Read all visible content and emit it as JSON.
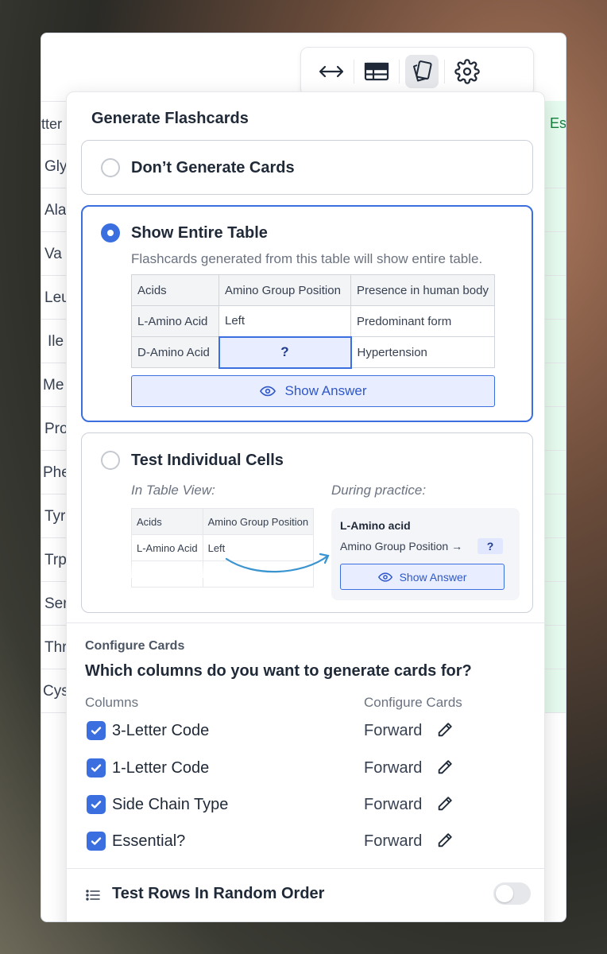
{
  "background_table": {
    "header_left": "tter",
    "header_right": "Es",
    "rows": [
      "Gly",
      "Ala",
      "Va",
      "Leu",
      "Ile",
      "Me",
      "Pro",
      "Phe",
      "Tyr",
      "Trp",
      "Ser",
      "Thr",
      "Cys"
    ]
  },
  "toolbar": {
    "buttons": [
      "expand-horizontal-icon",
      "table-icon",
      "flashcards-icon",
      "settings-icon"
    ],
    "active": "flashcards-icon"
  },
  "popover": {
    "title": "Generate Flashcards",
    "options": {
      "none": {
        "label": "Don’t Generate Cards",
        "selected": false
      },
      "entire": {
        "label": "Show Entire Table",
        "selected": true,
        "description": "Flashcards generated from this table will show entire table.",
        "table": {
          "headers": [
            "Acids",
            "Amino Group Position",
            "Presence in human body"
          ],
          "row1": [
            "L-Amino Acid",
            "Left",
            "Predominant form"
          ],
          "row2": [
            "D-Amino Acid",
            "?",
            "Hypertension"
          ]
        },
        "show_answer": "Show Answer"
      },
      "cells": {
        "label": "Test Individual Cells",
        "selected": false,
        "table_view_label": "In Table View:",
        "practice_label": "During practice:",
        "mini_table": {
          "headers": [
            "Acids",
            "Amino Group Position"
          ],
          "row1": [
            "L-Amino Acid",
            "Left"
          ]
        },
        "practice": {
          "title": "L-Amino acid",
          "question": "Amino Group Position →",
          "badge": "?",
          "show_answer": "Show Answer"
        }
      }
    },
    "configure": {
      "section_title": "Configure Cards",
      "question": "Which columns do you want to generate cards for?",
      "col_header_left": "Columns",
      "col_header_right": "Configure Cards",
      "columns": [
        {
          "name": "3-Letter Code",
          "direction": "Forward",
          "checked": true
        },
        {
          "name": "1-Letter Code",
          "direction": "Forward",
          "checked": true
        },
        {
          "name": "Side Chain Type",
          "direction": "Forward",
          "checked": true
        },
        {
          "name": "Essential?",
          "direction": "Forward",
          "checked": true
        }
      ]
    },
    "random_order": {
      "label": "Test Rows In Random Order",
      "enabled": false
    }
  },
  "colors": {
    "accent": "#3b6fe0",
    "accent_light": "#e8edff",
    "success": "#15803d"
  }
}
